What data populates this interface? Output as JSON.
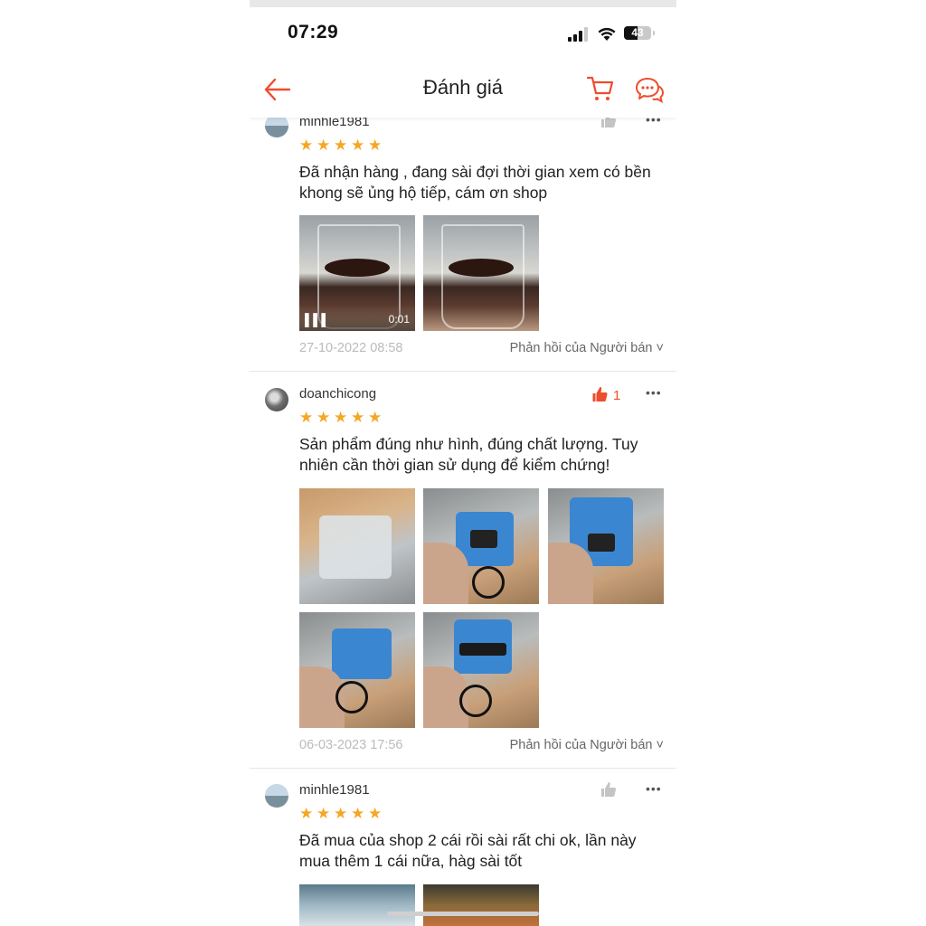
{
  "status_bar": {
    "time": "07:29",
    "battery": "43"
  },
  "header": {
    "title": "Đánh giá"
  },
  "reviews": [
    {
      "username": "minhle1981",
      "stars": 5,
      "text": "Đã nhận hàng , đang sài đợi thời gian xem có bền khong sẽ ủng hộ tiếp, cám ơn shop",
      "video_duration": "0:01",
      "date": "27-10-2022 08:58",
      "reply_label": "Phản hồi của Người bán ˅"
    },
    {
      "username": "doanchicong",
      "stars": 5,
      "like_count": "1",
      "text": "Sản phẩm đúng như hình, đúng chất lượng. Tuy nhiên cần thời gian sử dụng để kiểm chứng!",
      "date": "06-03-2023 17:56",
      "reply_label": "Phản hồi của Người bán ˅"
    },
    {
      "username": "minhle1981",
      "stars": 5,
      "text": "Đã mua của shop 2 cái rồi sài rất chi ok, lần này mua thêm 1 cái nữa, hàg sài tốt"
    }
  ],
  "colors": {
    "accent": "#ee4d2d",
    "star": "#f5a623"
  },
  "icons": [
    "back-arrow-icon",
    "cart-icon",
    "chat-icon",
    "thumbs-up-icon",
    "more-icon",
    "star-icon"
  ]
}
